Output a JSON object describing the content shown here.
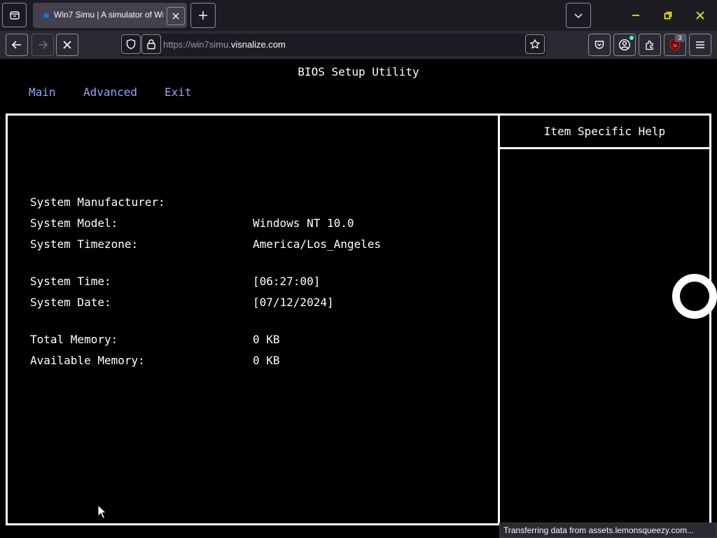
{
  "browser": {
    "tab": {
      "title": "Win7 Simu | A simulator of Wi"
    },
    "url": {
      "prefix": "https://win7simu.",
      "domain": "visnalize.com"
    },
    "ublock_badge": "3",
    "status_text": "Transferring data from assets.lemonsqueezy.com..."
  },
  "bios": {
    "title": "BIOS Setup Utility",
    "menu": {
      "main": "Main",
      "advanced": "Advanced",
      "exit": "Exit"
    },
    "help_title": "Item Specific Help",
    "fields": {
      "manufacturer": {
        "label": "System Manufacturer:",
        "value": ""
      },
      "model": {
        "label": "System Model:",
        "value": "Windows NT 10.0"
      },
      "timezone": {
        "label": "System Timezone:",
        "value": "America/Los_Angeles"
      },
      "time": {
        "label": "System Time:",
        "value": "[06:27:00]"
      },
      "date": {
        "label": "System Date:",
        "value": "[07/12/2024]"
      },
      "total_memory": {
        "label": "Total Memory:",
        "value": "0 KB"
      },
      "available_memory": {
        "label": "Available Memory:",
        "value": "0 KB"
      }
    },
    "colors": {
      "menu": "#9aa0ff",
      "text": "#ffffff",
      "background": "#000000"
    }
  },
  "icons": [
    "tab-list-icon",
    "close-icon",
    "plus-icon",
    "chevron-down-icon",
    "minimize-icon",
    "maximize-icon",
    "window-close-icon",
    "back-arrow-icon",
    "forward-arrow-icon",
    "stop-icon",
    "shield-icon",
    "lock-icon",
    "star-icon",
    "pocket-icon",
    "account-icon",
    "extensions-icon",
    "ublock-icon",
    "hamburger-menu-icon",
    "loading-ring-icon",
    "mouse-cursor-icon"
  ]
}
